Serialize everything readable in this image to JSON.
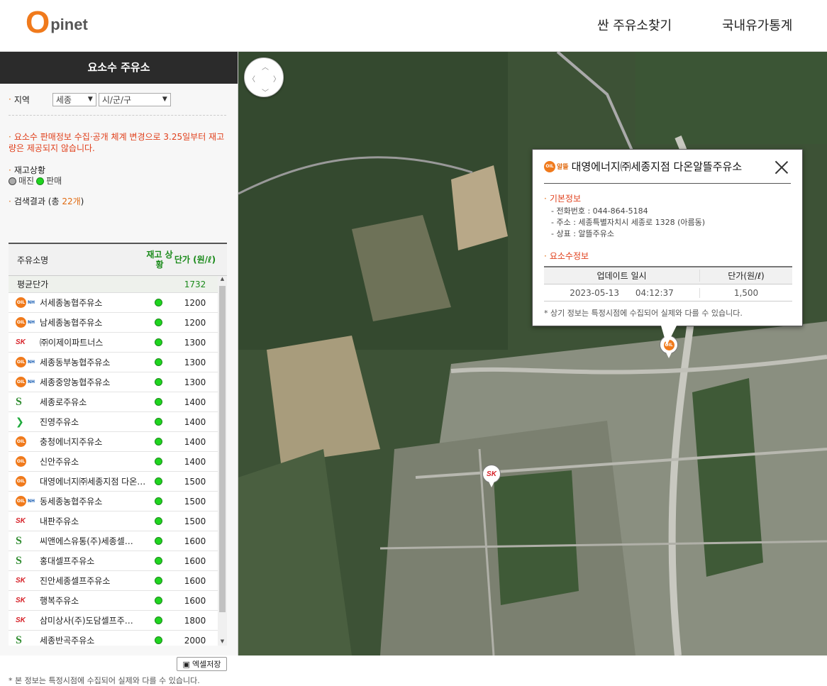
{
  "header": {
    "logo_o": "O",
    "logo_rest": "pinet",
    "nav": [
      "싼 주유소찾기",
      "국내유가통계"
    ]
  },
  "sidebar": {
    "title": "요소수 주유소",
    "region_label": "지역",
    "region_select": "세종",
    "district_select": "시/군/구",
    "notice": "요소수 판매정보 수집·공개 체계 변경으로 3.25일부터 재고량은 제공되지 않습니다.",
    "stock_title": "재고상황",
    "legend_soldout": "매진",
    "legend_sale": "판매",
    "result_prefix": "검색결과 (총 ",
    "result_count": "22개",
    "result_suffix": ")",
    "excel_button": "엑셀저장",
    "footnote": "* 본 정보는 특정시점에 수집되어 실제와 다를 수 있습니다."
  },
  "table": {
    "col_name": "주유소명",
    "col_stock": "재고 상황",
    "col_price": "단가 (원/ℓ)",
    "avg_label": "평균단가",
    "avg_price": "1732",
    "rows": [
      {
        "brand": "nh",
        "name": "서세종농협주유소",
        "price": "1200"
      },
      {
        "brand": "nh",
        "name": "남세종농협주유소",
        "price": "1200"
      },
      {
        "brand": "sk",
        "name": "㈜이제이파트너스",
        "price": "1300"
      },
      {
        "brand": "nh",
        "name": "세종동부농협주유소",
        "price": "1300"
      },
      {
        "brand": "nh",
        "name": "세종중앙농협주유소",
        "price": "1300"
      },
      {
        "brand": "s-oil",
        "name": "세종로주유소",
        "price": "1400"
      },
      {
        "brand": "chev",
        "name": "진영주유소",
        "price": "1400"
      },
      {
        "brand": "oil",
        "name": "충청에너지주유소",
        "price": "1400"
      },
      {
        "brand": "oil",
        "name": "신안주유소",
        "price": "1400"
      },
      {
        "brand": "oil",
        "name": "대영에너지㈜세종지점 다온…",
        "price": "1500"
      },
      {
        "brand": "nh",
        "name": "동세종농협주유소",
        "price": "1500"
      },
      {
        "brand": "sk",
        "name": "내판주유소",
        "price": "1500"
      },
      {
        "brand": "s-oil",
        "name": "씨앤에스유통(주)세종셀…",
        "price": "1600"
      },
      {
        "brand": "s-oil",
        "name": "홍대셀프주유소",
        "price": "1600"
      },
      {
        "brand": "sk",
        "name": "진안세종셀프주유소",
        "price": "1600"
      },
      {
        "brand": "sk",
        "name": "행복주유소",
        "price": "1600"
      },
      {
        "brand": "sk",
        "name": "삼미상사(주)도담셀프주…",
        "price": "1800"
      },
      {
        "brand": "s-oil",
        "name": "세종반곡주유소",
        "price": "2000"
      }
    ]
  },
  "popup": {
    "brand_text": "알뜰",
    "title": "대영에너지㈜세종지점 다온알뜰주유소",
    "basic_title": "기본정보",
    "phone": "- 전화번호 : 044-864-5184",
    "address": "- 주소 : 세종특별자치시 세종로 1328 (아름동)",
    "trademark": "- 상표 : 알뜰주유소",
    "urea_title": "요소수정보",
    "col_update": "업데이트 일시",
    "col_price": "단가(원/ℓ)",
    "update_date": "2023-05-13",
    "update_time": "04:12:37",
    "price": "1,500",
    "note": "* 상기 정보는 특정시점에 수집되어 실제와 다를 수 있습니다."
  },
  "colors": {
    "accent": "#f07a1c",
    "notice_red": "#e0401c",
    "stock_green": "#1fd41f",
    "sk_red": "#d61f26"
  }
}
